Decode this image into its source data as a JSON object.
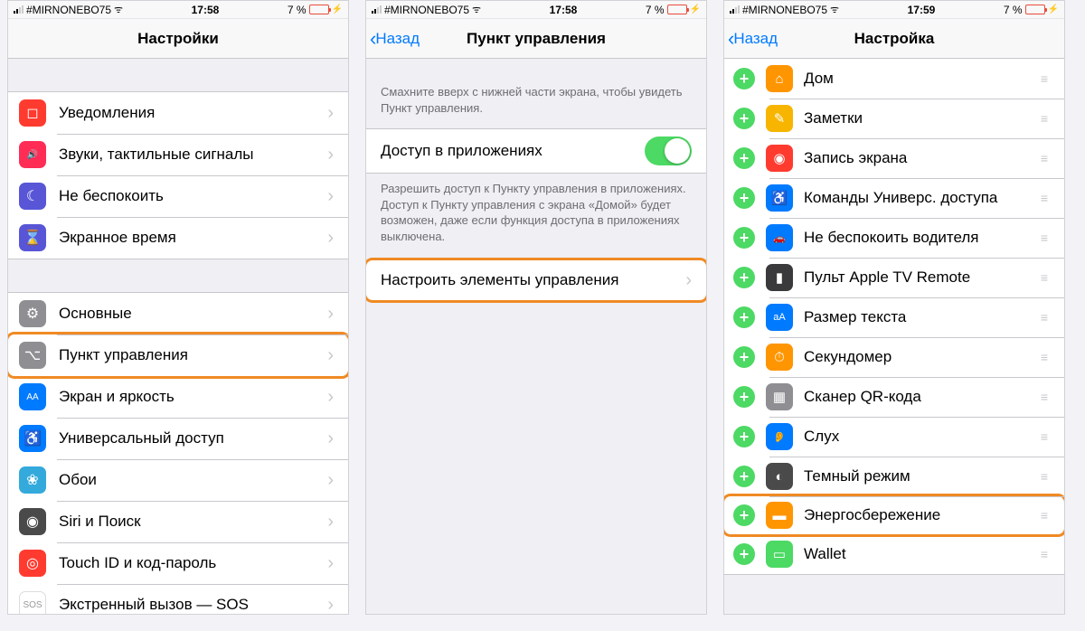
{
  "status": {
    "carrier": "#MIRNONEBO75",
    "battery_text": "7 %"
  },
  "screen1": {
    "time": "17:58",
    "title": "Настройки",
    "group1": [
      {
        "id": "notifications",
        "label": "Уведомления",
        "iconClass": "ic-red",
        "glyph": "◻"
      },
      {
        "id": "sounds",
        "label": "Звуки, тактильные сигналы",
        "iconClass": "ic-crimson",
        "glyph": "🔊"
      },
      {
        "id": "dnd",
        "label": "Не беспокоить",
        "iconClass": "ic-purple",
        "glyph": "☾"
      },
      {
        "id": "screentime",
        "label": "Экранное время",
        "iconClass": "ic-purple",
        "glyph": "⌛"
      }
    ],
    "group2": [
      {
        "id": "general",
        "label": "Основные",
        "iconClass": "ic-gray",
        "glyph": "⚙"
      },
      {
        "id": "control-center",
        "label": "Пункт управления",
        "iconClass": "ic-gray",
        "glyph": "⌥",
        "highlight": true
      },
      {
        "id": "display",
        "label": "Экран и яркость",
        "iconClass": "ic-blue",
        "glyph": "AA"
      },
      {
        "id": "accessibility",
        "label": "Универсальный доступ",
        "iconClass": "ic-blue",
        "glyph": "♿"
      },
      {
        "id": "wallpaper",
        "label": "Обои",
        "iconClass": "ic-teal",
        "glyph": "❀"
      },
      {
        "id": "siri",
        "label": "Siri и Поиск",
        "iconClass": "ic-dgray",
        "glyph": "◉"
      },
      {
        "id": "touchid",
        "label": "Touch ID и код-пароль",
        "iconClass": "ic-red",
        "glyph": "◎"
      },
      {
        "id": "sos",
        "label": "Экстренный вызов — SOS",
        "iconClass": "ic-white",
        "glyph": "SOS"
      }
    ]
  },
  "screen2": {
    "time": "17:58",
    "back": "Назад",
    "title": "Пункт управления",
    "intro": "Смахните вверх с нижней части экрана, чтобы увидеть Пункт управления.",
    "toggle_label": "Доступ в приложениях",
    "toggle_on": true,
    "toggle_help": "Разрешить доступ к Пункту управления в приложениях. Доступ к Пункту управления с экрана «Домой» будет возможен, даже если функция доступа в приложениях выключена.",
    "customize_label": "Настроить элементы управления"
  },
  "screen3": {
    "time": "17:59",
    "back": "Назад",
    "title": "Настройка",
    "items": [
      {
        "id": "home",
        "label": "Дом",
        "iconClass": "ic-orange",
        "glyph": "⌂"
      },
      {
        "id": "notes",
        "label": "Заметки",
        "iconClass": "ic-yellow",
        "glyph": "✎"
      },
      {
        "id": "screen-record",
        "label": "Запись экрана",
        "iconClass": "ic-red",
        "glyph": "◉"
      },
      {
        "id": "accessibility-shortcuts",
        "label": "Команды Универс. доступа",
        "iconClass": "ic-blue",
        "glyph": "♿"
      },
      {
        "id": "dnd-driving",
        "label": "Не беспокоить водителя",
        "iconClass": "ic-blue",
        "glyph": "🚗"
      },
      {
        "id": "apple-tv-remote",
        "label": "Пульт Apple TV Remote",
        "iconClass": "ic-darkgray",
        "glyph": "▮"
      },
      {
        "id": "text-size",
        "label": "Размер текста",
        "iconClass": "ic-blue",
        "glyph": "aA"
      },
      {
        "id": "stopwatch",
        "label": "Секундомер",
        "iconClass": "ic-orange",
        "glyph": "⏱"
      },
      {
        "id": "qr-scanner",
        "label": "Сканер QR-кода",
        "iconClass": "ic-gray",
        "glyph": "▦"
      },
      {
        "id": "hearing",
        "label": "Слух",
        "iconClass": "ic-blue",
        "glyph": "👂"
      },
      {
        "id": "dark-mode",
        "label": "Темный режим",
        "iconClass": "ic-dgray",
        "glyph": "◐"
      },
      {
        "id": "low-power",
        "label": "Энергосбережение",
        "iconClass": "ic-orange",
        "glyph": "▬",
        "highlight": true
      },
      {
        "id": "wallet",
        "label": "Wallet",
        "iconClass": "ic-green",
        "glyph": "▭"
      }
    ]
  }
}
